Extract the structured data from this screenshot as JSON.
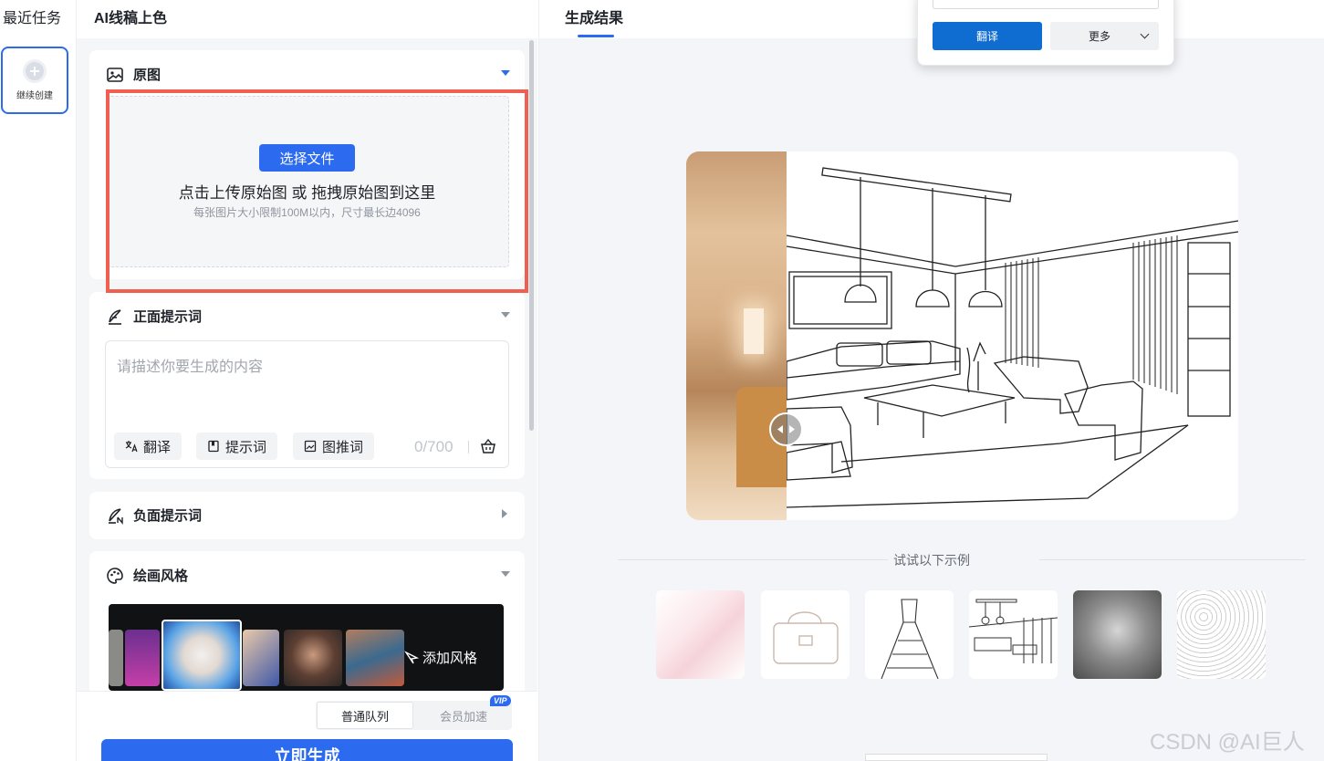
{
  "rail": {
    "title": "最近任务",
    "continue_label": "继续创建"
  },
  "panel": {
    "title": "AI线稿上色",
    "original": {
      "header": "原图",
      "choose_file": "选择文件",
      "upload_main": "点击上传原始图 或 拖拽原始图到这里",
      "upload_sub": "每张图片大小限制100M以内，尺寸最长边4096"
    },
    "positive": {
      "header": "正面提示词",
      "placeholder": "请描述你要生成的内容",
      "chips": [
        "翻译",
        "提示词",
        "图推词"
      ],
      "counter": "0/700"
    },
    "negative": {
      "header": "负面提示词"
    },
    "style": {
      "header": "绘画风格",
      "add_style": "添加风格"
    },
    "queue": {
      "normal": "普通队列",
      "vip": "会员加速",
      "vip_badge": "VIP"
    },
    "generate": "立即生成"
  },
  "result": {
    "tab": "生成结果",
    "examples_label": "试试以下示例"
  },
  "popup": {
    "translate": "翻译",
    "more": "更多"
  },
  "watermark": "CSDN @AI巨人",
  "colors": {
    "accent": "#2c6bf0",
    "highlight_box": "#f06050"
  }
}
